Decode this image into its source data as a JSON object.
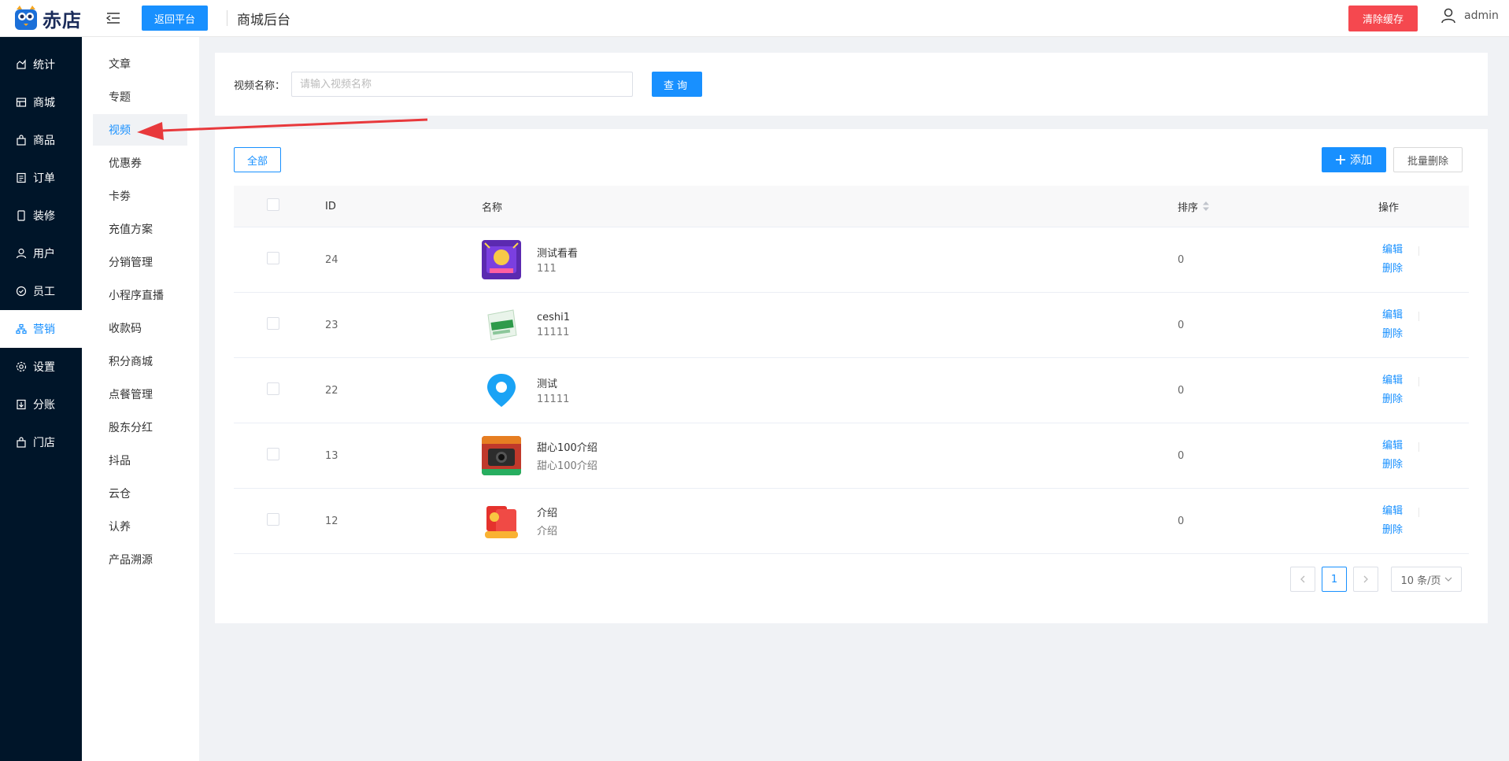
{
  "brand": {
    "logo_text": "赤店"
  },
  "header": {
    "back_label": "返回平台",
    "title": "商城后台",
    "clear_cache_label": "清除缓存",
    "user_name": "admin"
  },
  "sidebar": {
    "items": [
      {
        "label": "统计",
        "icon": "chart-icon"
      },
      {
        "label": "商城",
        "icon": "store-icon"
      },
      {
        "label": "商品",
        "icon": "bag-icon"
      },
      {
        "label": "订单",
        "icon": "order-icon"
      },
      {
        "label": "装修",
        "icon": "phone-icon"
      },
      {
        "label": "用户",
        "icon": "user-icon"
      },
      {
        "label": "员工",
        "icon": "shield-icon"
      },
      {
        "label": "营销",
        "icon": "network-icon",
        "active": true
      },
      {
        "label": "设置",
        "icon": "gear-icon"
      },
      {
        "label": "分账",
        "icon": "split-icon"
      },
      {
        "label": "门店",
        "icon": "shop-icon"
      }
    ]
  },
  "subnav": {
    "items": [
      "文章",
      "专题",
      "视频",
      "优惠券",
      "卡劵",
      "充值方案",
      "分销管理",
      "小程序直播",
      "收款码",
      "积分商城",
      "点餐管理",
      "股东分红",
      "抖品",
      "云仓",
      "认养",
      "产品溯源"
    ],
    "active_index": 2
  },
  "search": {
    "label": "视频名称：",
    "placeholder": "请输入视频名称",
    "value": "",
    "query_label": "查询"
  },
  "toolbar": {
    "filter_all": "全部",
    "add_label": "添加",
    "batch_delete_label": "批量删除"
  },
  "table": {
    "headers": {
      "id": "ID",
      "name": "名称",
      "sort": "排序",
      "op": "操作"
    },
    "op_edit": "编辑",
    "op_delete": "删除",
    "rows": [
      {
        "id": "24",
        "title": "测试看看",
        "sub": "111",
        "sort": "0",
        "thumb": "purple-poster"
      },
      {
        "id": "23",
        "title": "ceshi1",
        "sub": "11111",
        "sort": "0",
        "thumb": "green-package"
      },
      {
        "id": "22",
        "title": "测试",
        "sub": "11111",
        "sort": "0",
        "thumb": "location-pin"
      },
      {
        "id": "13",
        "title": "甜心100介绍",
        "sub": "甜心100介绍",
        "sort": "0",
        "thumb": "camera-product"
      },
      {
        "id": "12",
        "title": "介绍",
        "sub": "介绍",
        "sort": "0",
        "thumb": "red-envelope"
      }
    ]
  },
  "pagination": {
    "current": "1",
    "page_size": "10 条/页"
  },
  "colors": {
    "primary": "#1890ff",
    "danger": "#f5484f",
    "sidebar_bg": "#001529",
    "annotation_arrow": "#e8393c"
  }
}
